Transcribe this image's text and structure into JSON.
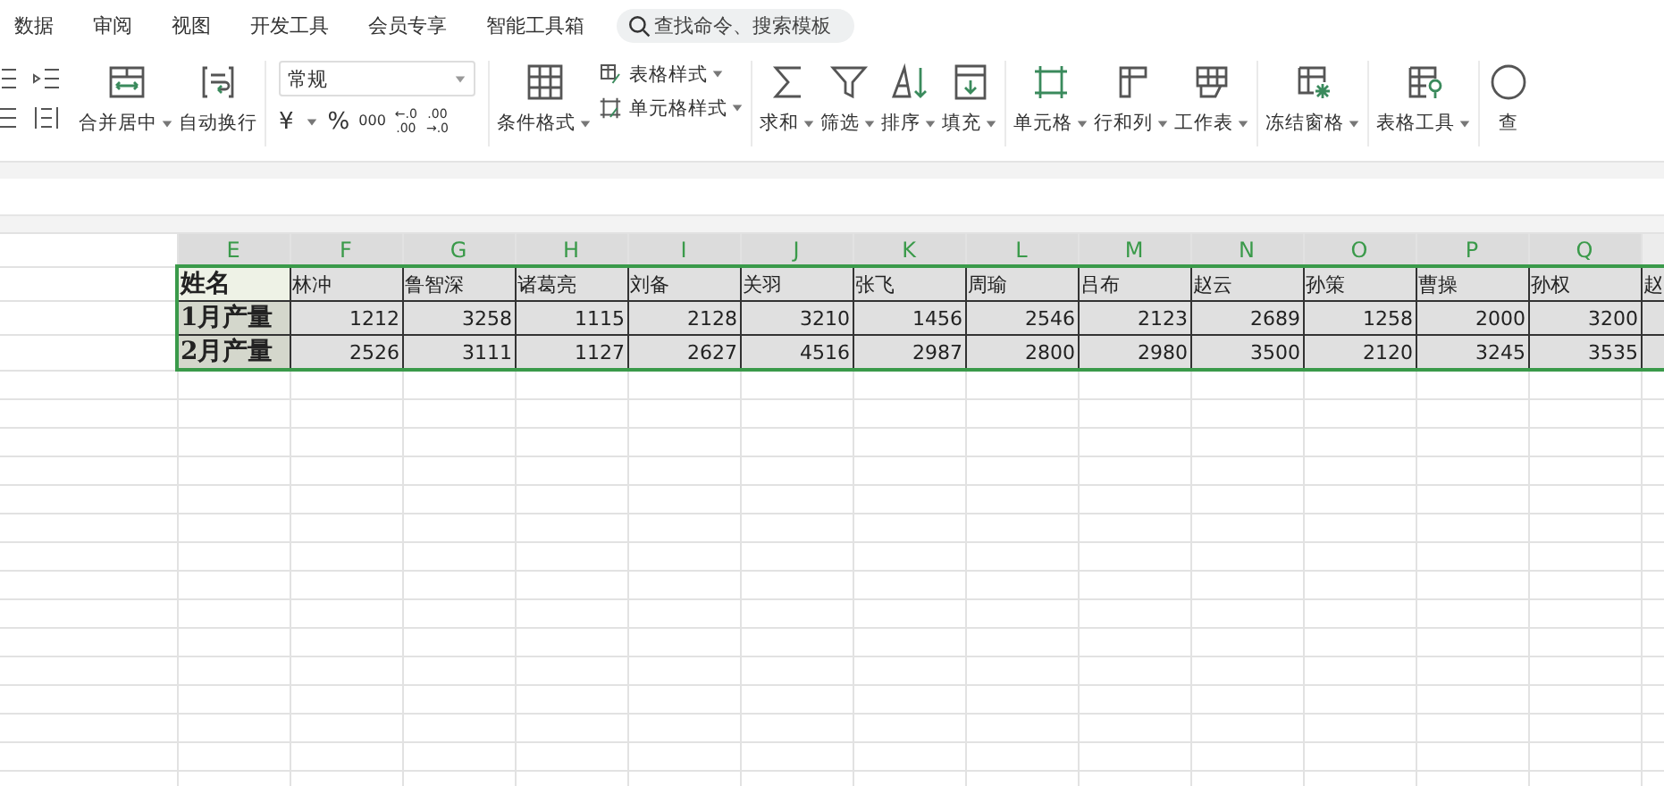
{
  "menu_tabs": [
    {
      "label": "数据",
      "selected": false
    },
    {
      "label": "审阅",
      "selected": false
    },
    {
      "label": "视图",
      "selected": false
    },
    {
      "label": "开发工具",
      "selected": false
    },
    {
      "label": "会员专享",
      "selected": false
    },
    {
      "label": "智能工具箱",
      "selected": false
    }
  ],
  "search": {
    "placeholder": "查找命令、搜索模板"
  },
  "ribbon": {
    "groups": [
      [
        {
          "kind": "indent"
        },
        {
          "kind": "big",
          "label": "合并居中",
          "dropdown": true
        },
        {
          "kind": "big",
          "label": "自动换行",
          "dropdown": false
        }
      ],
      [
        {
          "kind": "number",
          "value": "常规",
          "currency": "¥",
          "percent": "%",
          "thousands": "000",
          "add_decimal": [
            "←.0",
            ".00"
          ],
          "remove_decimal": [
            ".00",
            "→.0"
          ]
        }
      ],
      [
        {
          "kind": "big",
          "label": "条件格式",
          "dropdown": true
        },
        {
          "kind": "stack",
          "items": [
            {
              "label": "表格样式",
              "dropdown": true
            },
            {
              "label": "单元格样式",
              "dropdown": true
            }
          ]
        }
      ],
      [
        {
          "kind": "big",
          "label": "求和",
          "dropdown": true
        },
        {
          "kind": "big",
          "label": "筛选",
          "dropdown": true
        },
        {
          "kind": "big",
          "label": "排序",
          "dropdown": true
        },
        {
          "kind": "big",
          "label": "填充",
          "dropdown": true
        }
      ],
      [
        {
          "kind": "big",
          "label": "单元格",
          "dropdown": true
        },
        {
          "kind": "big",
          "label": "行和列",
          "dropdown": true
        },
        {
          "kind": "big",
          "label": "工作表",
          "dropdown": true
        }
      ],
      [
        {
          "kind": "big",
          "label": "冻结窗格",
          "dropdown": true
        }
      ],
      [
        {
          "kind": "big",
          "label": "表格工具",
          "dropdown": true
        }
      ],
      [
        {
          "kind": "big",
          "label": "查",
          "dropdown": false
        }
      ]
    ]
  },
  "sheet": {
    "columns": [
      {
        "label": "E",
        "selected": true
      },
      {
        "label": "F",
        "selected": true
      },
      {
        "label": "G",
        "selected": true
      },
      {
        "label": "H",
        "selected": true
      },
      {
        "label": "I",
        "selected": true
      },
      {
        "label": "J",
        "selected": true
      },
      {
        "label": "K",
        "selected": true
      },
      {
        "label": "L",
        "selected": true
      },
      {
        "label": "M",
        "selected": true
      },
      {
        "label": "N",
        "selected": true
      },
      {
        "label": "O",
        "selected": true
      },
      {
        "label": "P",
        "selected": true
      },
      {
        "label": "Q",
        "selected": true
      }
    ],
    "rows": [
      {
        "selected": true,
        "cells": [
          "姓名",
          "林冲",
          "鲁智深",
          "诸葛亮",
          "刘备",
          "关羽",
          "张飞",
          "周瑜",
          "吕布",
          "赵云",
          "孙策",
          "曹操",
          "孙权",
          "赵"
        ]
      },
      {
        "selected": true,
        "cells": [
          "1月产量",
          "1212",
          "3258",
          "1115",
          "2128",
          "3210",
          "1456",
          "2546",
          "2123",
          "2689",
          "1258",
          "2000",
          "3200"
        ]
      },
      {
        "selected": true,
        "cells": [
          "2月产量",
          "2526",
          "3111",
          "1127",
          "2627",
          "4516",
          "2987",
          "2800",
          "2980",
          "3500",
          "2120",
          "3245",
          "3535"
        ]
      }
    ]
  }
}
